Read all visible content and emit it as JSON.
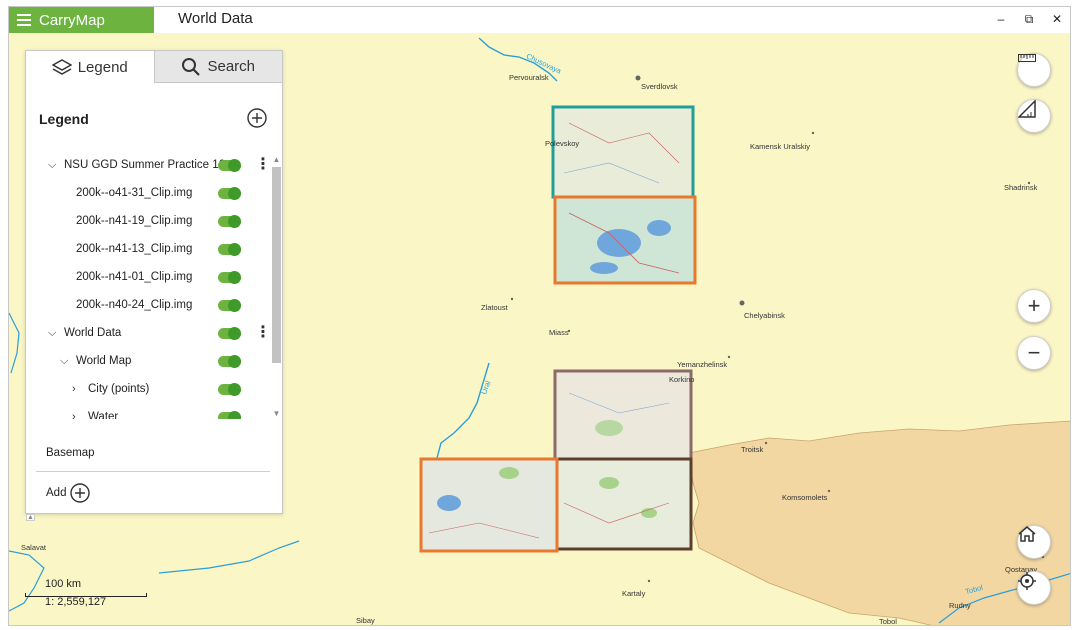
{
  "app": {
    "name": "CarryMap",
    "document_title": "World Data"
  },
  "window_controls": {
    "minimize": "–",
    "restore": "⧉",
    "close": "✕"
  },
  "panel": {
    "tabs": [
      {
        "label": "Legend",
        "icon": "layers-icon",
        "active": true
      },
      {
        "label": "Search",
        "icon": "search-icon",
        "active": false
      }
    ],
    "title": "Legend",
    "layers": [
      {
        "label": "NSU GGD Summer Practice 16",
        "expanded": true,
        "on": true,
        "menu": true
      },
      {
        "label": "200k--o41-31_Clip.img",
        "on": true
      },
      {
        "label": "200k--n41-19_Clip.img",
        "on": true
      },
      {
        "label": "200k--n41-13_Clip.img",
        "on": true
      },
      {
        "label": "200k--n41-01_Clip.img",
        "on": true
      },
      {
        "label": "200k--n40-24_Clip.img",
        "on": true
      },
      {
        "label": "World Data",
        "expanded": true,
        "on": true,
        "menu": true
      },
      {
        "label": "World Map",
        "expanded": true,
        "on": true
      },
      {
        "label": "City (points)",
        "expanded": false,
        "on": true
      },
      {
        "label": "Water",
        "expanded": false,
        "on": true
      }
    ],
    "basemap_label": "Basemap",
    "add_label": "Add"
  },
  "map": {
    "cities": [
      {
        "name": "Pervouralsk"
      },
      {
        "name": "Sverdlovsk"
      },
      {
        "name": "Polevskoy"
      },
      {
        "name": "Kamensk Uralskiy"
      },
      {
        "name": "Shadrinsk"
      },
      {
        "name": "Zlatoust"
      },
      {
        "name": "Miass"
      },
      {
        "name": "Chelyabinsk"
      },
      {
        "name": "Korkino"
      },
      {
        "name": "Yemanzhelinsk"
      },
      {
        "name": "Troitsk"
      },
      {
        "name": "Komsomolets"
      },
      {
        "name": "Salavat"
      },
      {
        "name": "Kartaly"
      },
      {
        "name": "Sibay"
      },
      {
        "name": "Tobol"
      },
      {
        "name": "Rudny"
      },
      {
        "name": "Qostanay"
      }
    ],
    "rivers": [
      {
        "name": "Chusovaya"
      },
      {
        "name": "Ural"
      },
      {
        "name": "Tobol"
      }
    ],
    "scale": {
      "distance": "100 km",
      "ratio": "1: 2,559,127"
    },
    "colors": {
      "land": "#fbf6c6",
      "kazakhstan": "#f2d7a3",
      "water": "#2a9fd8",
      "accent": "#6cb33f"
    }
  }
}
